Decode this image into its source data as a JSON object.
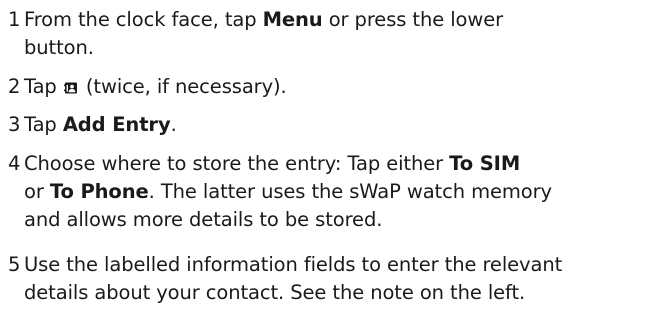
{
  "steps": [
    {
      "number": "1",
      "text_before": "From the clock face, tap ",
      "bold": "Menu",
      "text_after": " or press the lower",
      "line2": "button."
    },
    {
      "number": "2",
      "text_before": "Tap ",
      "icon": "contacts-icon",
      "text_after": " (twice, if necessary)."
    },
    {
      "number": "3",
      "text_before": "Tap ",
      "bold": "Add Entry",
      "text_after": "."
    },
    {
      "number": "4",
      "text_before": "Choose where to store the entry: Tap either ",
      "bold": "To SIM",
      "line2_before": "or ",
      "line2_bold": "To Phone",
      "line2_after": ". The latter uses the sWaP watch memory",
      "line3": "and allows more details to be stored."
    },
    {
      "number": "5",
      "line1": "Use the labelled information fields to enter the relevant",
      "line2": "details about your contact. See the note on the left."
    }
  ]
}
